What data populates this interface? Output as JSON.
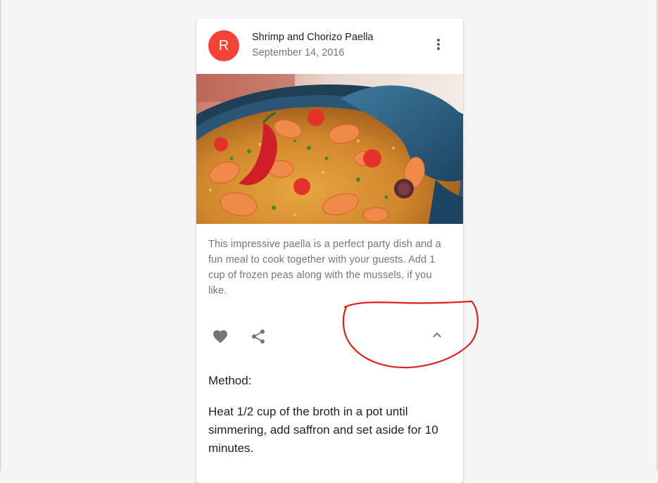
{
  "card": {
    "avatar_letter": "R",
    "title": "Shrimp and Chorizo Paella",
    "subheader": "September 14, 2016",
    "image_alt": "Paella dish",
    "description": "This impressive paella is a perfect party dish and a fun meal to cook together with your guests. Add 1 cup of frozen peas along with the mussels, if you like.",
    "actions": {
      "favorite_icon": "heart-icon",
      "share_icon": "share-icon",
      "expand_icon": "chevron-up-icon",
      "more_icon": "more-vert-icon"
    },
    "expanded": {
      "method_label": "Method:",
      "steps": [
        "Heat 1/2 cup of the broth in a pot until simmering, add saffron and set aside for 10 minutes."
      ]
    }
  },
  "colors": {
    "avatar_bg": "#f44336",
    "annotation": "#e0201c",
    "page_bg": "#f5f5f5"
  }
}
